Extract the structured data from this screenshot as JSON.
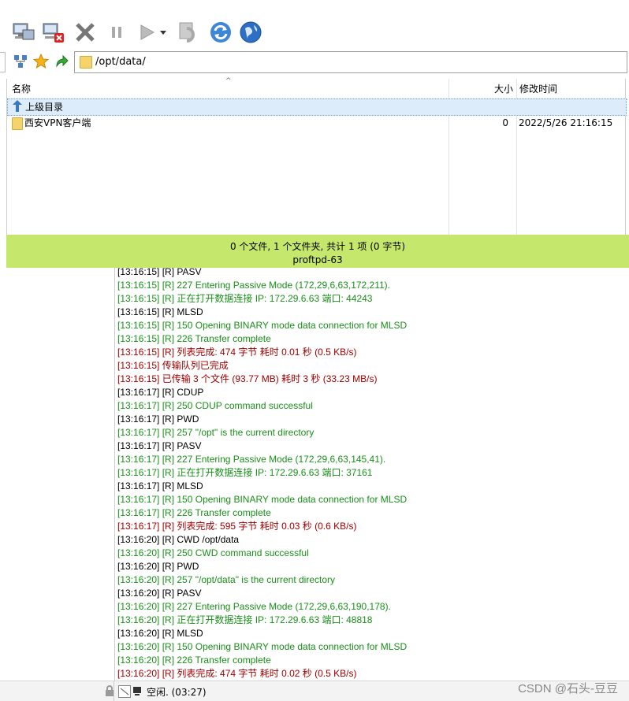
{
  "toolbar": {
    "icons": [
      "connect-icon",
      "disconnect-icon",
      "stop-icon",
      "pause-icon",
      "play-icon",
      "dropdown-arrow-icon",
      "reconnect-icon",
      "refresh-icon",
      "globe-icon"
    ]
  },
  "address": {
    "path": "/opt/data/"
  },
  "filelist": {
    "headers": {
      "name": "名称",
      "size": "大小",
      "modified": "修改时间"
    },
    "rows": [
      {
        "name": "上级目录",
        "size": "",
        "modified": ""
      },
      {
        "name": "西安VPN客户端",
        "size": "0",
        "modified": "2022/5/26 21:16:15"
      }
    ]
  },
  "status": {
    "summary": "0 个文件, 1 个文件夹, 共计 1 项 (0 字节)",
    "server": "proftpd-63"
  },
  "colors": {
    "green": "#1a8f1a",
    "red": "#a00000",
    "black": "#000000",
    "status_bg": "#c5e86c"
  },
  "log": [
    {
      "text": "[13:16:15] [R] PASV",
      "color": "black"
    },
    {
      "text": "[13:16:15] [R] 227 Entering Passive Mode (172,29,6,63,172,211).",
      "color": "green"
    },
    {
      "text": "[13:16:15] [R] 正在打开数据连接 IP: 172.29.6.63 端口: 44243",
      "color": "green"
    },
    {
      "text": "[13:16:15] [R] MLSD",
      "color": "black"
    },
    {
      "text": "[13:16:15] [R] 150 Opening BINARY mode data connection for MLSD",
      "color": "green"
    },
    {
      "text": "[13:16:15] [R] 226 Transfer complete",
      "color": "green"
    },
    {
      "text": "[13:16:15] [R] 列表完成: 474 字节 耗时 0.01 秒 (0.5 KB/s)",
      "color": "red"
    },
    {
      "text": "[13:16:15] 传输队列已完成",
      "color": "red"
    },
    {
      "text": "[13:16:15] 已传输 3 个文件 (93.77 MB) 耗时 3 秒 (33.23 MB/s)",
      "color": "red"
    },
    {
      "text": "[13:16:17] [R] CDUP",
      "color": "black"
    },
    {
      "text": "[13:16:17] [R] 250 CDUP command successful",
      "color": "green"
    },
    {
      "text": "[13:16:17] [R] PWD",
      "color": "black"
    },
    {
      "text": "[13:16:17] [R] 257 \"/opt\" is the current directory",
      "color": "green"
    },
    {
      "text": "[13:16:17] [R] PASV",
      "color": "black"
    },
    {
      "text": "[13:16:17] [R] 227 Entering Passive Mode (172,29,6,63,145,41).",
      "color": "green"
    },
    {
      "text": "[13:16:17] [R] 正在打开数据连接 IP: 172.29.6.63 端口: 37161",
      "color": "green"
    },
    {
      "text": "[13:16:17] [R] MLSD",
      "color": "black"
    },
    {
      "text": "[13:16:17] [R] 150 Opening BINARY mode data connection for MLSD",
      "color": "green"
    },
    {
      "text": "[13:16:17] [R] 226 Transfer complete",
      "color": "green"
    },
    {
      "text": "[13:16:17] [R] 列表完成: 595 字节 耗时 0.03 秒 (0.6 KB/s)",
      "color": "red"
    },
    {
      "text": "[13:16:20] [R] CWD /opt/data",
      "color": "black"
    },
    {
      "text": "[13:16:20] [R] 250 CWD command successful",
      "color": "green"
    },
    {
      "text": "[13:16:20] [R] PWD",
      "color": "black"
    },
    {
      "text": "[13:16:20] [R] 257 \"/opt/data\" is the current directory",
      "color": "green"
    },
    {
      "text": "[13:16:20] [R] PASV",
      "color": "black"
    },
    {
      "text": "[13:16:20] [R] 227 Entering Passive Mode (172,29,6,63,190,178).",
      "color": "green"
    },
    {
      "text": "[13:16:20] [R] 正在打开数据连接 IP: 172.29.6.63 端口: 48818",
      "color": "green"
    },
    {
      "text": "[13:16:20] [R] MLSD",
      "color": "black"
    },
    {
      "text": "[13:16:20] [R] 150 Opening BINARY mode data connection for MLSD",
      "color": "green"
    },
    {
      "text": "[13:16:20] [R] 226 Transfer complete",
      "color": "green"
    },
    {
      "text": "[13:16:20] [R] 列表完成: 474 字节 耗时 0.02 秒 (0.5 KB/s)",
      "color": "red"
    }
  ],
  "bottom": {
    "status": "空闲. (03:27)",
    "watermark": "CSDN @石头-豆豆"
  }
}
